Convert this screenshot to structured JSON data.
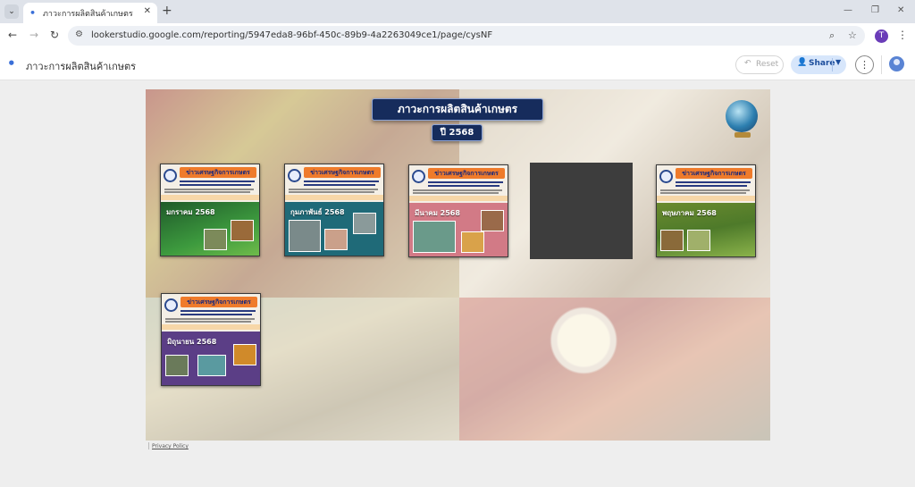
{
  "browser": {
    "tab_title": "ภาวะการผลิตสินค้าเกษตร",
    "url": "lookerstudio.google.com/reporting/5947eda8-96bf-450c-89b9-4a2263049ce1/page/cysNF",
    "profile_initial": "T"
  },
  "app": {
    "report_title": "ภาวะการผลิตสินค้าเกษตร",
    "reset_label": "Reset",
    "share_label": "Share"
  },
  "canvas": {
    "title": "ภาวะการผลิตสินค้าเกษตร",
    "year": "ปี 2568",
    "cards": [
      {
        "banner": "ข่าวเศรษฐกิจการเกษตร",
        "month": "มกราคม 2568",
        "theme": "#2e8a3a"
      },
      {
        "banner": "ข่าวเศรษฐกิจการเกษตร",
        "month": "กุมภาพันธ์ 2568",
        "theme": "#1f6a78"
      },
      {
        "banner": "ข่าวเศรษฐกิจการเกษตร",
        "month": "มีนาคม 2568",
        "theme": "#d27a86"
      },
      {
        "banner": "ข่าวเศรษฐกิจการเกษตร",
        "month": "พฤษภาคม 2568",
        "theme": "#5a8a2e"
      },
      {
        "banner": "ข่าวเศรษฐกิจการเกษตร",
        "month": "มิถุนายน 2568",
        "theme": "#5b3e86"
      }
    ]
  },
  "footer": {
    "privacy_label": "Privacy Policy"
  }
}
